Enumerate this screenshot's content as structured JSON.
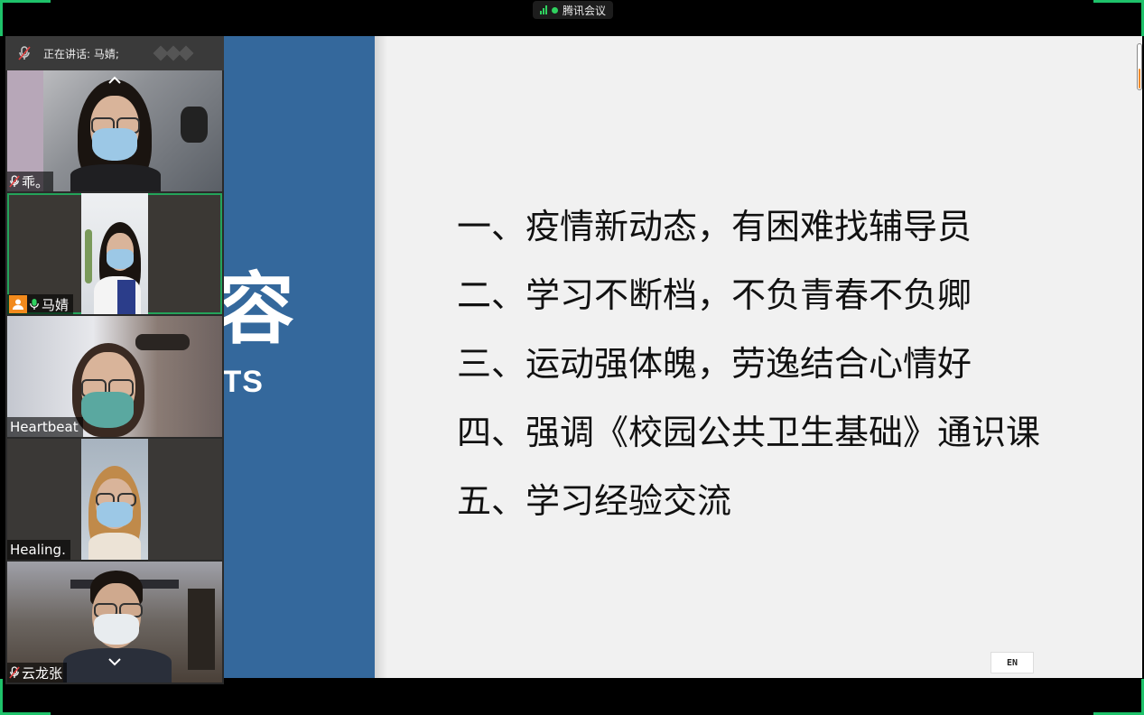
{
  "app": {
    "title": "腾讯会议"
  },
  "speaker_bar": {
    "text": "正在讲话: 马婧;"
  },
  "participants": [
    {
      "name": "乖。",
      "mic": "muted"
    },
    {
      "name": "马婧",
      "mic": "active"
    },
    {
      "name": "Heartbeat",
      "mic": "none"
    },
    {
      "name": "Healing.",
      "mic": "none"
    },
    {
      "name": "云龙张",
      "mic": "muted"
    }
  ],
  "slide": {
    "side_title": "容",
    "side_subtitle": "ITS",
    "items": [
      "一、疫情新动态，有困难找辅导员",
      "二、学习不断档，不负青春不负卿",
      "三、运动强体魄，劳逸结合心情好",
      "四、强调《校园公共卫生基础》通识课",
      "五、学习经验交流"
    ]
  },
  "ime_badge": "EN",
  "colors": {
    "accent_green": "#1ec26a",
    "slide_blue": "#34689c",
    "badge_orange": "#f28a1c"
  }
}
